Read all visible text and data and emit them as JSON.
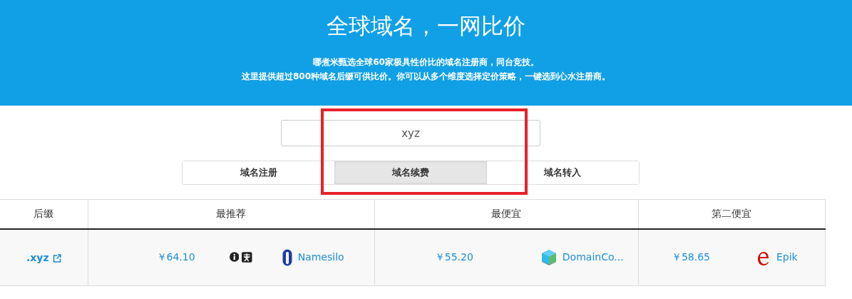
{
  "header": {
    "title": "全球域名，一网比价",
    "lines": [
      "哪煮米甄选全球60家极具性价比的域名注册商，同台竞技。",
      "这里提供超过800种域名后缀可供比价。你可以从多个维度选择定价策略，一键选到心水注册商。"
    ]
  },
  "search": {
    "value": "xyz"
  },
  "tabs": [
    {
      "label": "域名注册",
      "selected": false
    },
    {
      "label": "域名续费",
      "selected": true
    },
    {
      "label": "域名转入",
      "selected": false
    }
  ],
  "annotation": {
    "kind": "box"
  },
  "table": {
    "columns": [
      "后缀",
      "最推荐",
      "最便宜",
      "第二便宜"
    ],
    "rows": [
      {
        "cells": [
          {
            "kind": "suffix",
            "text": ".xyz"
          },
          {
            "kind": "offer",
            "price": "￥64.10",
            "badges": [
              {
                "kind": "info"
              },
              {
                "kind": "alipay"
              }
            ],
            "registrar": "Namesilo",
            "logo": {
              "kind": "capsule"
            }
          },
          {
            "kind": "offer",
            "price": "￥55.20",
            "registrar": "DomainCo...",
            "logo": {
              "kind": "cube"
            }
          },
          {
            "kind": "offer",
            "price": "￥58.65",
            "registrar": "Epik",
            "logo": {
              "kind": "letter-e"
            }
          }
        ]
      }
    ]
  }
}
